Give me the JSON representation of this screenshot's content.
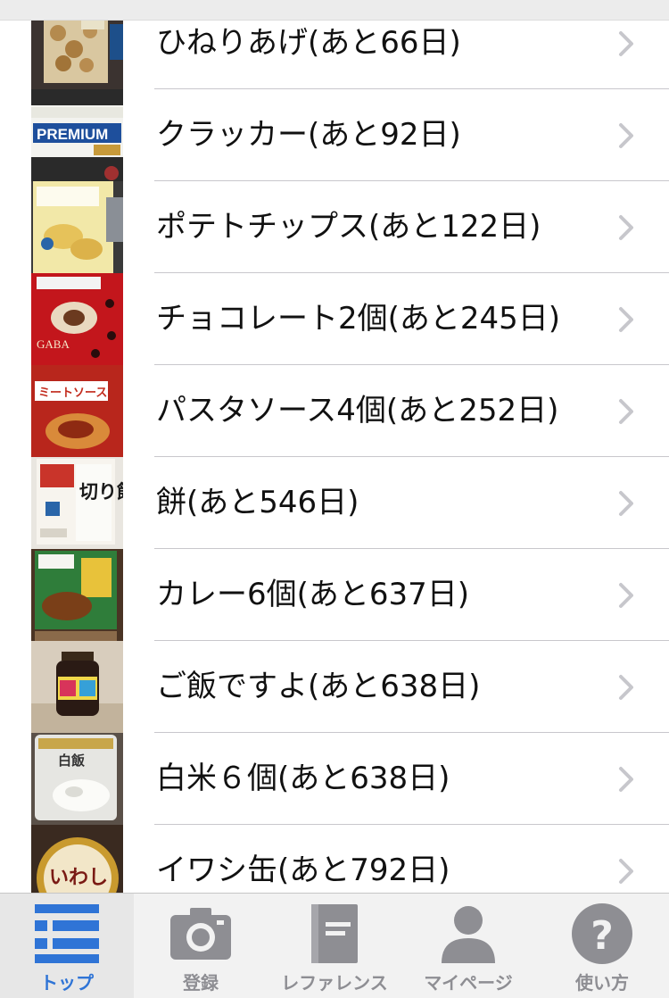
{
  "list": {
    "items": [
      {
        "label": "ひねりあげ(あと66日)",
        "thumb": "snack-bag"
      },
      {
        "label": "クラッカー(あと92日)",
        "thumb": "cracker-box"
      },
      {
        "label": "ポテトチップス(あと122日)",
        "thumb": "chips-bag"
      },
      {
        "label": "チョコレート2個(あと245日)",
        "thumb": "chocolate-box"
      },
      {
        "label": "パスタソース4個(あと252日)",
        "thumb": "pasta-sauce-pack"
      },
      {
        "label": "餅(あと546日)",
        "thumb": "mochi-pack"
      },
      {
        "label": "カレー6個(あと637日)",
        "thumb": "curry-box"
      },
      {
        "label": "ご飯ですよ(あと638日)",
        "thumb": "seasoning-jar"
      },
      {
        "label": "白米６個(あと638日)",
        "thumb": "rice-pouch"
      },
      {
        "label": "イワシ缶(あと792日)",
        "thumb": "sardine-can"
      }
    ]
  },
  "thumb_text": {
    "cracker": "PREMIUM",
    "chocolate": "GABA",
    "pasta": "ミートソース",
    "mochi": "切り餅",
    "rice": "白飯",
    "sardine": "いわし"
  },
  "tabbar": {
    "tabs": [
      {
        "label": "トップ",
        "icon": "list-icon",
        "active": true
      },
      {
        "label": "登録",
        "icon": "camera-icon",
        "active": false
      },
      {
        "label": "レファレンス",
        "icon": "book-icon",
        "active": false
      },
      {
        "label": "マイページ",
        "icon": "person-icon",
        "active": false
      },
      {
        "label": "使い方",
        "icon": "question-icon",
        "active": false
      }
    ]
  },
  "colors": {
    "accent": "#2f74d6",
    "inactive_tab": "#8e8e93",
    "separator": "#c8c7cc"
  }
}
